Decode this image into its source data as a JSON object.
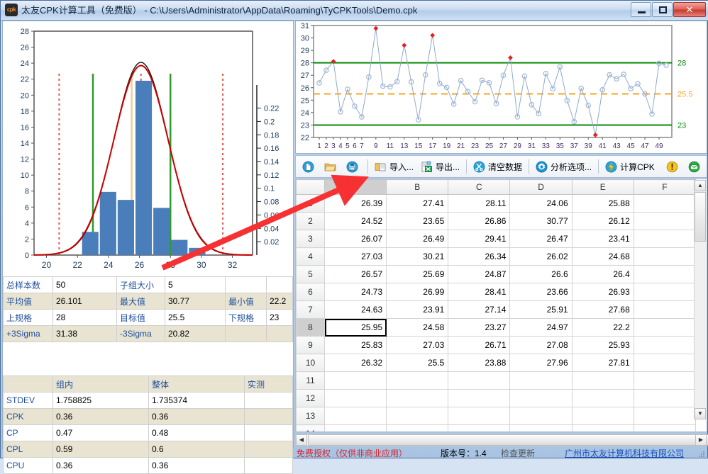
{
  "window": {
    "title": "太友CPK计算工具（免费版） - C:\\Users\\Administrator\\AppData\\Roaming\\TyCPKTools\\Demo.cpk",
    "app_icon_text": "cpk",
    "minimize_label": "",
    "maximize_label": "",
    "close_label": "✕"
  },
  "toolbar": {
    "items": [
      {
        "name": "new",
        "icon": "new-document-icon",
        "label": ""
      },
      {
        "name": "open",
        "icon": "open-folder-icon",
        "label": ""
      },
      {
        "name": "save",
        "icon": "save-disk-icon",
        "label": ""
      },
      {
        "name": "import",
        "icon": "import-icon",
        "label": "导入..."
      },
      {
        "name": "export",
        "icon": "export-excel-icon",
        "label": "导出..."
      },
      {
        "name": "clear",
        "icon": "scissors-icon",
        "label": "清空数据"
      },
      {
        "name": "options",
        "icon": "gear-icon",
        "label": "分析选项..."
      },
      {
        "name": "calc",
        "icon": "lightning-icon",
        "label": "计算CPK"
      },
      {
        "name": "about",
        "icon": "exclamation-icon",
        "label": ""
      },
      {
        "name": "mail",
        "icon": "mail-icon",
        "label": ""
      }
    ]
  },
  "stats_top": {
    "rows": [
      [
        {
          "label": "总样本数",
          "value": "50"
        },
        {
          "label": "子组大小",
          "value": "5"
        },
        {
          "label": "",
          "value": ""
        }
      ],
      [
        {
          "label": "平均值",
          "value": "26.101"
        },
        {
          "label": "最大值",
          "value": "30.77"
        },
        {
          "label": "最小值",
          "value": "22.2"
        }
      ],
      [
        {
          "label": "上规格",
          "value": "28"
        },
        {
          "label": "目标值",
          "value": "25.5"
        },
        {
          "label": "下规格",
          "value": "23"
        }
      ],
      [
        {
          "label": "+3Sigma",
          "value": "31.38"
        },
        {
          "label": "-3Sigma",
          "value": "20.82"
        },
        {
          "label": "",
          "value": ""
        }
      ]
    ]
  },
  "stats_bottom": {
    "headers": [
      "",
      "组内",
      "整体",
      "实测"
    ],
    "rows": [
      {
        "label": "STDEV",
        "within": "1.758825",
        "overall": "1.735374",
        "measured": ""
      },
      {
        "label": "CPK",
        "within": "0.36",
        "overall": "0.36",
        "measured": ""
      },
      {
        "label": "CP",
        "within": "0.47",
        "overall": "0.48",
        "measured": ""
      },
      {
        "label": "CPL",
        "within": "0.59",
        "overall": "0.6",
        "measured": ""
      },
      {
        "label": "CPU",
        "within": "0.36",
        "overall": "0.36",
        "measured": ""
      }
    ]
  },
  "grid": {
    "columns": [
      "A",
      "B",
      "C",
      "D",
      "E",
      "F"
    ],
    "selected_column": "A",
    "selected_row": "8",
    "active_cell": "A8",
    "rows": [
      {
        "num": "1",
        "cells": [
          "26.39",
          "27.41",
          "28.11",
          "24.06",
          "25.88",
          ""
        ]
      },
      {
        "num": "2",
        "cells": [
          "24.52",
          "23.65",
          "26.86",
          "30.77",
          "26.12",
          ""
        ]
      },
      {
        "num": "3",
        "cells": [
          "26.07",
          "26.49",
          "29.41",
          "26.47",
          "23.41",
          ""
        ]
      },
      {
        "num": "4",
        "cells": [
          "27.03",
          "30.21",
          "26.34",
          "26.02",
          "24.68",
          ""
        ]
      },
      {
        "num": "5",
        "cells": [
          "26.57",
          "25.69",
          "24.87",
          "26.6",
          "26.4",
          ""
        ]
      },
      {
        "num": "6",
        "cells": [
          "24.73",
          "26.99",
          "28.41",
          "23.66",
          "26.93",
          ""
        ]
      },
      {
        "num": "7",
        "cells": [
          "24.63",
          "23.91",
          "27.14",
          "25.91",
          "27.68",
          ""
        ]
      },
      {
        "num": "8",
        "cells": [
          "25.95",
          "24.58",
          "23.27",
          "24.97",
          "22.2",
          ""
        ]
      },
      {
        "num": "9",
        "cells": [
          "25.83",
          "27.03",
          "26.71",
          "27.08",
          "25.93",
          ""
        ]
      },
      {
        "num": "10",
        "cells": [
          "26.32",
          "25.5",
          "23.88",
          "27.96",
          "27.81",
          ""
        ]
      },
      {
        "num": "11",
        "cells": [
          "",
          "",
          "",
          "",
          "",
          ""
        ]
      },
      {
        "num": "12",
        "cells": [
          "",
          "",
          "",
          "",
          "",
          ""
        ]
      },
      {
        "num": "13",
        "cells": [
          "",
          "",
          "",
          "",
          "",
          ""
        ]
      },
      {
        "num": "14",
        "cells": [
          "",
          "",
          "",
          "",
          "",
          ""
        ]
      }
    ]
  },
  "status": {
    "license": "免费授权（仅供非商业应用）",
    "version": "版本号：1.4",
    "update": "检查更新",
    "company": "广州市太友计算机科技有限公司"
  },
  "chart_data": [
    {
      "type": "bar",
      "name": "histogram",
      "title": "",
      "xlabel": "",
      "ylabel": "",
      "xlim": [
        19.2,
        33.3
      ],
      "ylim": [
        0,
        28
      ],
      "y_ticks": [
        0,
        2,
        4,
        6,
        8,
        10,
        12,
        14,
        16,
        18,
        20,
        22,
        24,
        26,
        28
      ],
      "x_ticks": [
        20,
        22,
        24,
        26,
        28,
        30,
        32
      ],
      "y2_ticks": [
        0.02,
        0.04,
        0.06,
        0.08,
        0.1,
        0.12,
        0.14,
        0.16,
        0.18,
        0.2,
        0.22
      ],
      "y2lim": [
        0,
        0.2545
      ],
      "bar_color": "#4a7ebb",
      "bins": [
        {
          "left": 22.25,
          "right": 23.4,
          "count": 2.9
        },
        {
          "left": 23.4,
          "right": 24.55,
          "count": 7.9
        },
        {
          "left": 24.55,
          "right": 25.7,
          "count": 6.9
        },
        {
          "left": 25.7,
          "right": 26.85,
          "count": 21.8
        },
        {
          "left": 26.85,
          "right": 28.0,
          "count": 5.9
        },
        {
          "left": 28.0,
          "right": 29.15,
          "count": 1.9
        },
        {
          "left": 29.15,
          "right": 30.3,
          "count": 0.9
        }
      ],
      "curves": [
        {
          "name": "overall-normal",
          "color": "#000000",
          "mean": 26.101,
          "sigma": 1.735374,
          "peak": 24.1
        },
        {
          "name": "within-normal",
          "color": "#cc0000",
          "mean": 26.101,
          "sigma": 1.758825,
          "peak": 23.7
        }
      ],
      "vlines": [
        {
          "name": "LSL",
          "x": 23,
          "color": "#2e9b2e",
          "style": "solid"
        },
        {
          "name": "USL",
          "x": 28,
          "color": "#2e9b2e",
          "style": "solid"
        },
        {
          "name": "target",
          "x": 25.5,
          "color": "#f2cf9a",
          "style": "solid"
        },
        {
          "name": "mean",
          "x": 26.101,
          "color": "#e8504a",
          "style": "dotted"
        },
        {
          "name": "-3sigma",
          "x": 20.82,
          "color": "#e8504a",
          "style": "dotted"
        },
        {
          "name": "+3sigma",
          "x": 31.38,
          "color": "#e8504a",
          "style": "dotted"
        }
      ]
    },
    {
      "type": "line",
      "name": "run-chart",
      "title": "",
      "xlabel": "",
      "ylabel": "",
      "ylim": [
        22,
        31
      ],
      "y_ticks": [
        22,
        23,
        24,
        25,
        26,
        27,
        28,
        29,
        30,
        31
      ],
      "x_ticks": [
        1,
        2,
        3,
        4,
        5,
        6,
        7,
        9,
        11,
        13,
        15,
        17,
        19,
        21,
        23,
        25,
        27,
        29,
        31,
        33,
        35,
        37,
        39,
        41,
        43,
        45,
        47,
        49
      ],
      "line_color": "#8fa9cd",
      "marker_color": "#9fb6d6",
      "out_of_spec_color": "#e81d1d",
      "ref_lines": [
        {
          "name": "USL",
          "value": 28,
          "color": "#0a8a0a",
          "style": "solid",
          "label": "28"
        },
        {
          "name": "target",
          "value": 25.5,
          "color": "#f5a623",
          "style": "dashed",
          "label": "25.5"
        },
        {
          "name": "LSL",
          "value": 23,
          "color": "#0a8a0a",
          "style": "solid",
          "label": "23"
        }
      ],
      "x": [
        1,
        2,
        3,
        4,
        5,
        6,
        7,
        8,
        9,
        10,
        11,
        12,
        13,
        14,
        15,
        16,
        17,
        18,
        19,
        20,
        21,
        22,
        23,
        24,
        25,
        26,
        27,
        28,
        29,
        30,
        31,
        32,
        33,
        34,
        35,
        36,
        37,
        38,
        39,
        40,
        41,
        42,
        43,
        44,
        45,
        46,
        47,
        48,
        49,
        50
      ],
      "values": [
        26.39,
        27.41,
        28.11,
        24.06,
        25.88,
        24.52,
        23.65,
        26.86,
        30.77,
        26.12,
        26.07,
        26.49,
        29.41,
        26.47,
        23.41,
        27.03,
        30.21,
        26.34,
        26.02,
        24.68,
        26.57,
        25.69,
        24.87,
        26.6,
        26.4,
        24.73,
        26.99,
        28.41,
        23.66,
        26.93,
        24.63,
        23.91,
        27.14,
        25.91,
        27.68,
        24.97,
        23.27,
        25.95,
        24.58,
        22.2,
        25.83,
        27.03,
        26.71,
        27.08,
        25.93,
        26.32,
        25.5,
        23.88,
        27.96,
        27.81
      ]
    }
  ]
}
